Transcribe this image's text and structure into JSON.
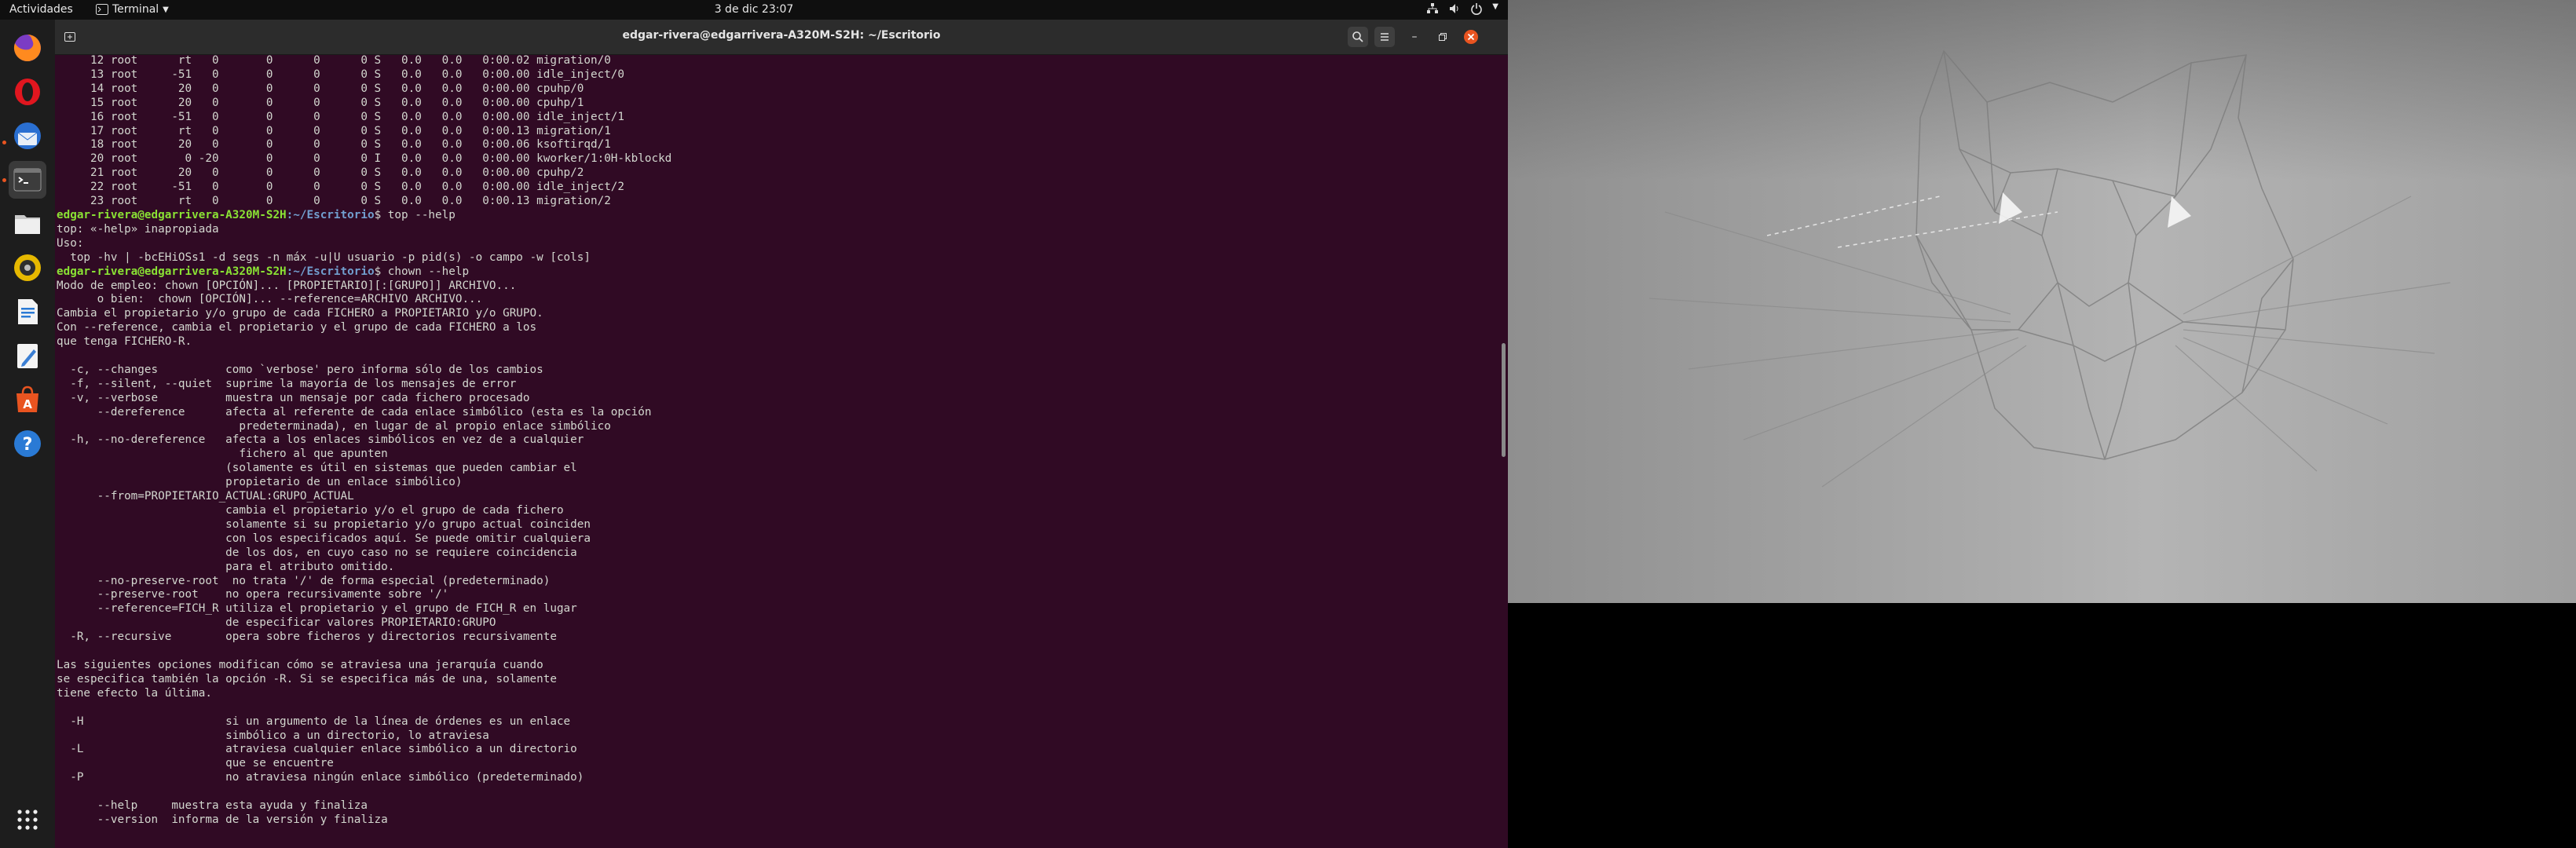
{
  "topbar": {
    "activities": "Actividades",
    "app_menu": "Terminal",
    "clock": "3 de dic  23:07",
    "status_icons": [
      "network-icon",
      "volume-icon",
      "power-icon",
      "chevron-down-icon"
    ]
  },
  "dock": {
    "items": [
      {
        "name": "firefox",
        "icon": "firefox-icon"
      },
      {
        "name": "opera",
        "icon": "opera-icon"
      },
      {
        "name": "thunderbird",
        "icon": "thunderbird-icon"
      },
      {
        "name": "terminal",
        "icon": "terminal-icon",
        "active": true
      },
      {
        "name": "files",
        "icon": "folder-icon"
      },
      {
        "name": "rhythmbox",
        "icon": "speaker-icon"
      },
      {
        "name": "writer",
        "icon": "writer-icon"
      },
      {
        "name": "text-editor",
        "icon": "pencil-icon"
      },
      {
        "name": "software",
        "icon": "software-icon"
      },
      {
        "name": "help",
        "icon": "help-icon"
      },
      {
        "name": "show-apps",
        "icon": "grid-icon"
      }
    ]
  },
  "terminal": {
    "title": "edgar-rivera@edgarrivera-A320M-S2H: ~/Escritorio",
    "prompt_user": "edgar-rivera@edgarrivera-A320M-S2H",
    "prompt_path": ":~/Escritorio",
    "lines_top": [
      "     12 root      rt   0       0      0      0 S   0.0   0.0   0:00.02 migration/0",
      "     13 root     -51   0       0      0      0 S   0.0   0.0   0:00.00 idle_inject/0",
      "     14 root      20   0       0      0      0 S   0.0   0.0   0:00.00 cpuhp/0",
      "     15 root      20   0       0      0      0 S   0.0   0.0   0:00.00 cpuhp/1",
      "     16 root     -51   0       0      0      0 S   0.0   0.0   0:00.00 idle_inject/1",
      "     17 root      rt   0       0      0      0 S   0.0   0.0   0:00.13 migration/1",
      "     18 root      20   0       0      0      0 S   0.0   0.0   0:00.06 ksoftirqd/1",
      "     20 root       0 -20       0      0      0 I   0.0   0.0   0:00.00 kworker/1:0H-kblockd",
      "     21 root      20   0       0      0      0 S   0.0   0.0   0:00.00 cpuhp/2",
      "     22 root     -51   0       0      0      0 S   0.0   0.0   0:00.00 idle_inject/2",
      "     23 root      rt   0       0      0      0 S   0.0   0.0   0:00.13 migration/2"
    ],
    "cmd1": "$ top --help",
    "lines_mid": [
      "top: «-help» inapropiada",
      "Uso:",
      "  top -hv | -bcEHiOSs1 -d segs -n máx -u|U usuario -p pid(s) -o campo -w [cols]"
    ],
    "cmd2": "$ chown --help",
    "lines_bottom": [
      "Modo de empleo: chown [OPCIÓN]... [PROPIETARIO][:[GRUPO]] ARCHIVO...",
      "      o bien:  chown [OPCIÓN]... --reference=ARCHIVO ARCHIVO...",
      "Cambia el propietario y/o grupo de cada FICHERO a PROPIETARIO y/o GRUPO.",
      "Con --reference, cambia el propietario y el grupo de cada FICHERO a los",
      "que tenga FICHERO-R.",
      "",
      "  -c, --changes          como `verbose' pero informa sólo de los cambios",
      "  -f, --silent, --quiet  suprime la mayoría de los mensajes de error",
      "  -v, --verbose          muestra un mensaje por cada fichero procesado",
      "      --dereference      afecta al referente de cada enlace simbólico (esta es la opción",
      "                           predeterminada), en lugar de al propio enlace simbólico",
      "  -h, --no-dereference   afecta a los enlaces simbólicos en vez de a cualquier",
      "                           fichero al que apunten",
      "                         (solamente es útil en sistemas que pueden cambiar el",
      "                         propietario de un enlace simbólico)",
      "      --from=PROPIETARIO_ACTUAL:GRUPO_ACTUAL",
      "                         cambia el propietario y/o el grupo de cada fichero",
      "                         solamente si su propietario y/o grupo actual coinciden",
      "                         con los especificados aquí. Se puede omitir cualquiera",
      "                         de los dos, en cuyo caso no se requiere coincidencia",
      "                         para el atributo omitido.",
      "      --no-preserve-root  no trata '/' de forma especial (predeterminado)",
      "      --preserve-root    no opera recursivamente sobre '/'",
      "      --reference=FICH_R utiliza el propietario y el grupo de FICH_R en lugar",
      "                         de especificar valores PROPIETARIO:GRUPO",
      "  -R, --recursive        opera sobre ficheros y directorios recursivamente",
      "",
      "Las siguientes opciones modifican cómo se atraviesa una jerarquía cuando",
      "se especifica también la opción -R. Si se especifica más de una, solamente",
      "tiene efecto la última.",
      "",
      "  -H                     si un argumento de la línea de órdenes es un enlace",
      "                         simbólico a un directorio, lo atraviesa",
      "  -L                     atraviesa cualquier enlace simbólico a un directorio",
      "                         que se encuentre",
      "  -P                     no atraviesa ningún enlace simbólico (predeterminado)",
      "",
      "      --help     muestra esta ayuda y finaliza",
      "      --version  informa de la versión y finaliza"
    ]
  },
  "colors": {
    "terminal_bg": "#300a24",
    "prompt_user": "#8ae234",
    "prompt_path": "#729fcf",
    "accent": "#e95420"
  }
}
